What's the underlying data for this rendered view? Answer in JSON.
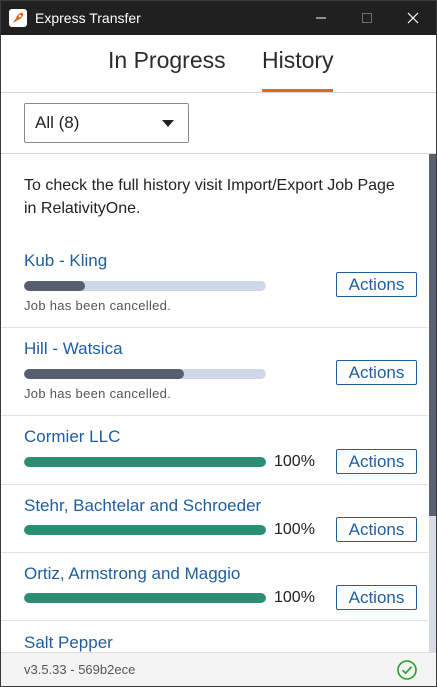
{
  "window": {
    "title": "Express Transfer"
  },
  "tabs": [
    {
      "label": "In Progress",
      "active": false
    },
    {
      "label": "History",
      "active": true
    }
  ],
  "accent_color": "#e8651c",
  "filter": {
    "selected": "All (8)"
  },
  "info_text": "To check the full history visit Import/Export Job Page in RelativityOne.",
  "jobs": [
    {
      "name": "Kub - Kling",
      "progress": 0.25,
      "state": "cancelled",
      "status": "Job has been cancelled.",
      "percent_label": "",
      "action_label": "Actions"
    },
    {
      "name": "Hill - Watsica",
      "progress": 0.66,
      "state": "cancelled",
      "status": "Job has been cancelled.",
      "percent_label": "",
      "action_label": "Actions"
    },
    {
      "name": "Cormier LLC",
      "progress": 1.0,
      "state": "done",
      "status": "",
      "percent_label": "100%",
      "action_label": "Actions"
    },
    {
      "name": "Stehr, Bachtelar and Schroeder",
      "progress": 1.0,
      "state": "done",
      "status": "",
      "percent_label": "100%",
      "action_label": "Actions"
    },
    {
      "name": "Ortiz, Armstrong and Maggio",
      "progress": 1.0,
      "state": "done",
      "status": "",
      "percent_label": "100%",
      "action_label": "Actions"
    },
    {
      "name": "Salt Pepper",
      "progress": null,
      "state": "partial",
      "status": "",
      "percent_label": "",
      "action_label": ""
    }
  ],
  "footer": {
    "version": "v3.5.33 - 569b2ece",
    "status_icon": "check-circle-icon",
    "status_color": "#2a9d2a"
  }
}
